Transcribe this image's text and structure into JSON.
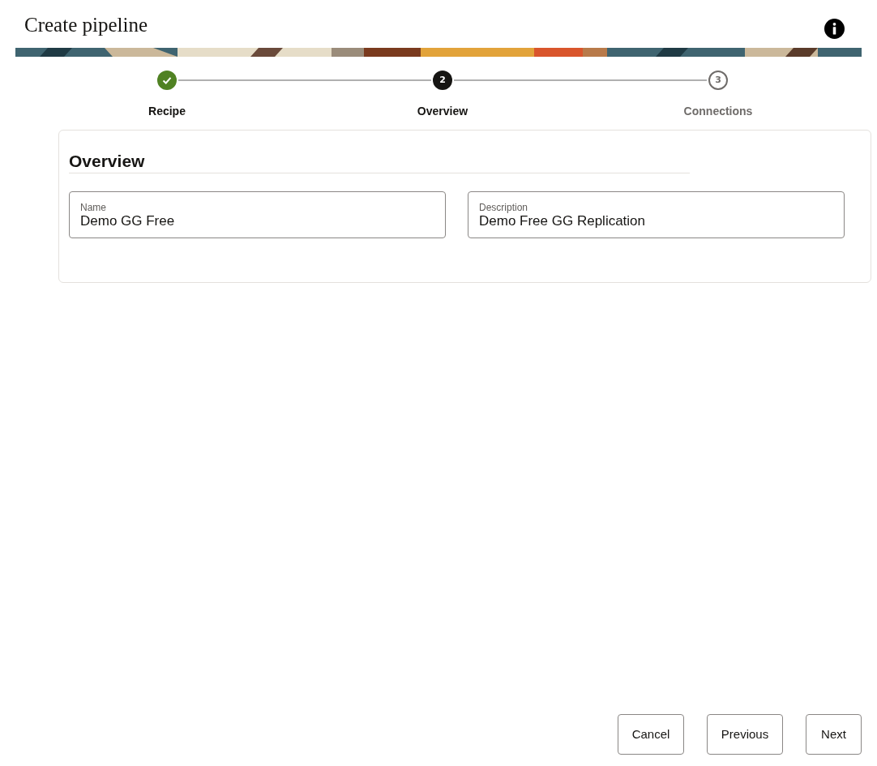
{
  "header": {
    "title": "Create pipeline"
  },
  "steps": [
    {
      "label": "Recipe",
      "kind": "complete"
    },
    {
      "number": "2",
      "label": "Overview",
      "kind": "current"
    },
    {
      "number": "3",
      "label": "Connections",
      "kind": "upcoming"
    }
  ],
  "section": {
    "heading": "Overview",
    "fields": [
      {
        "label": "Name",
        "value": "Demo GG Free"
      },
      {
        "label": "Description",
        "value": "Demo Free GG Replication"
      }
    ]
  },
  "buttons": [
    "Cancel",
    "Previous",
    "Next"
  ]
}
